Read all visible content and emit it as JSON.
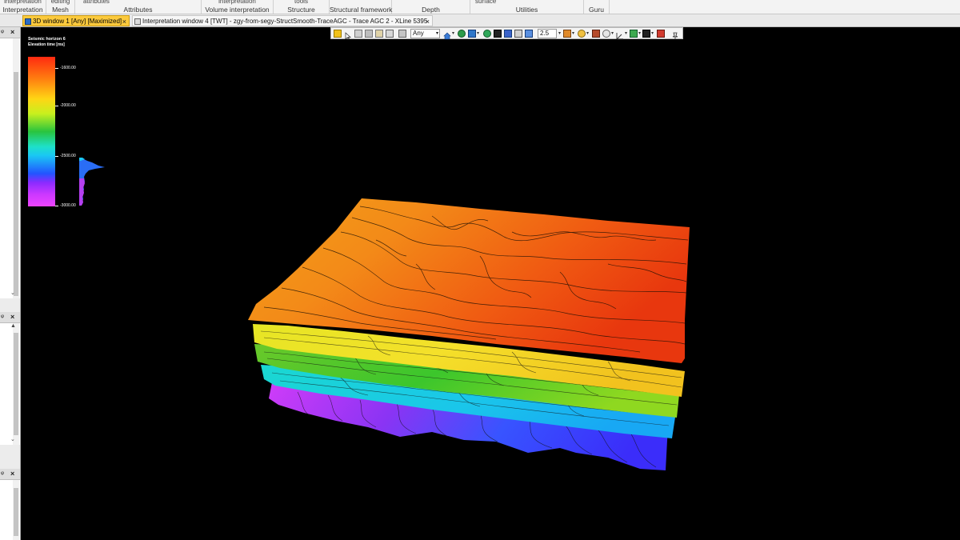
{
  "ribbon": {
    "groups": [
      {
        "top_partial": "interpretation",
        "name": "Interpretation"
      },
      {
        "top_partial": "editing",
        "name": "Mesh"
      },
      {
        "top_partial": "attributes",
        "name": "Attributes"
      },
      {
        "top_partial": "interpretation",
        "name": "Volume interpretation"
      },
      {
        "top_partial": "tools",
        "name": "Structure"
      },
      {
        "top_partial": "",
        "name": "Structural framework"
      },
      {
        "top_partial": "",
        "name": "Depth"
      },
      {
        "top_partial": "surface",
        "name": "Utilities"
      },
      {
        "top_partial": "",
        "name": "Guru"
      }
    ]
  },
  "tabs": {
    "active": {
      "label": "3D window 1 [Any] [Maximized]",
      "close": "×"
    },
    "inactive": {
      "label": "Interpretation window 4 [TWT] - zgy-from-segy-StructSmooth-TraceAGC - Trace AGC 2 - XLine 5395",
      "close": "×"
    }
  },
  "left_panels": {
    "pin": "ᵠ",
    "close": "×",
    "up": "▲",
    "down": "⌄"
  },
  "toolbar": {
    "mode": "Any",
    "zoom": "2.5",
    "dropdown": "▾"
  },
  "legend": {
    "title": "Seismic horizon 6",
    "subtitle": "Elevation time [ms]",
    "ticks": [
      "-1600.00",
      "-2000.00",
      "-2500.00",
      "-3000.00"
    ]
  },
  "colors": {
    "accent_tab": "#fcca3d",
    "background": "#000000",
    "ribbon": "#f3f3f3"
  }
}
